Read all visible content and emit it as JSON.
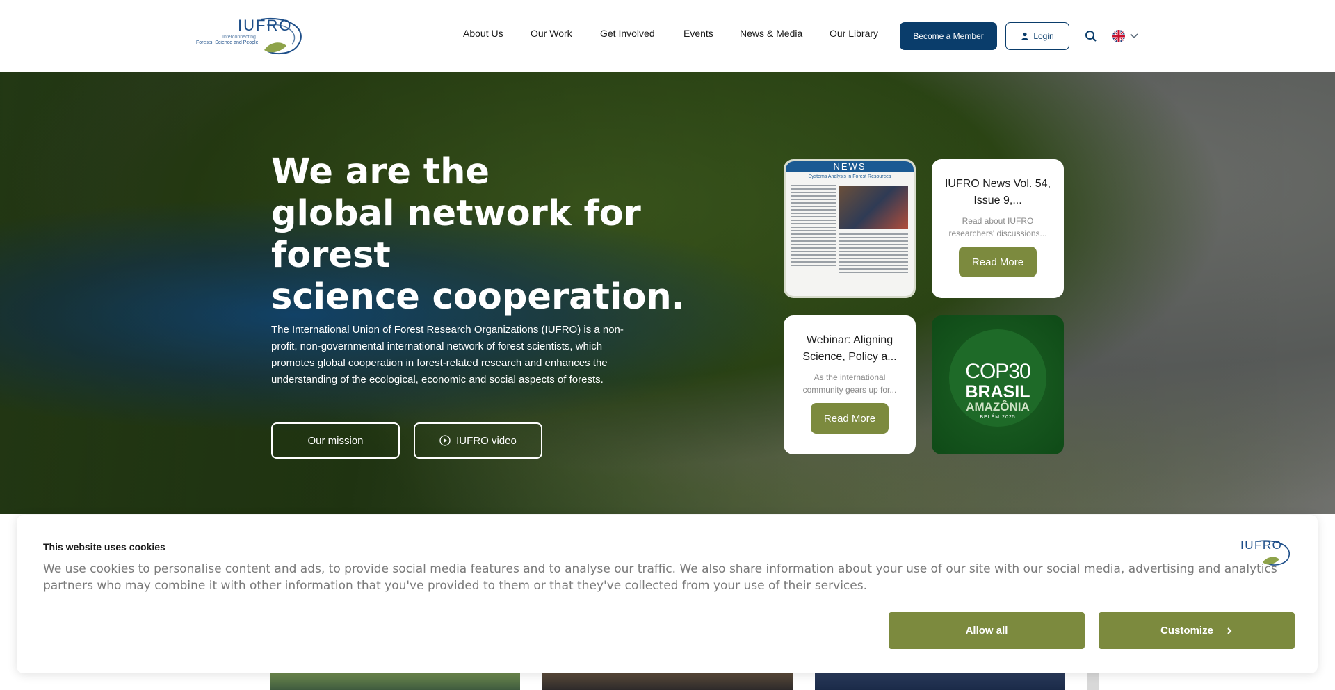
{
  "header": {
    "logo": {
      "name": "IUFRO",
      "tagline_line1": "Interconnecting",
      "tagline_line2": "Forests, Science and People"
    },
    "nav": [
      {
        "label": "About Us"
      },
      {
        "label": "Our Work"
      },
      {
        "label": "Get Involved"
      },
      {
        "label": "Events"
      },
      {
        "label": "News & Media"
      },
      {
        "label": "Our Library"
      }
    ],
    "member_label": "Become a Member",
    "login_label": "Login",
    "icons": {
      "search": "search-icon",
      "user": "user-icon",
      "language": "uk-flag-icon",
      "dropdown": "chevron-down-icon"
    }
  },
  "hero": {
    "title_line1": "We are the",
    "title_line2": "global network for forest",
    "title_line3": "science cooperation.",
    "description": "The International Union of Forest Research Organizations (IUFRO) is a non-profit, non-governmental international network of forest scientists, which promotes global cooperation in forest-related research and enhances the understanding of the ecological, economic and social aspects of forests.",
    "mission_label": "Our mission",
    "video_label": "IUFRO video"
  },
  "cards": {
    "news_image": {
      "heading": "NEWS",
      "subheading": "Systems Analysis in Forest Resources"
    },
    "news": {
      "title": "IUFRO News Vol. 54, Issue 9,...",
      "text": "Read about IUFRO researchers' discussions...",
      "button": "Read More"
    },
    "webinar": {
      "title": "Webinar: Aligning Science, Policy a...",
      "text": "As the international community gears up for...",
      "button": "Read More"
    },
    "cop": {
      "line1": "COP30",
      "line2": "BRASIL",
      "line3": "AMAZÔNIA",
      "line4": "BELÉM 2025"
    }
  },
  "cookie": {
    "title": "This website uses cookies",
    "text": "We use cookies to personalise content and ads, to provide social media features and to analyse our traffic. We also share information about your use of our site with our social media, advertising and analytics partners who may combine it with other information that you've provided to them or that they've collected from your use of their services.",
    "logo": "IUFRO",
    "allow_label": "Allow all",
    "customize_label": "Customize"
  },
  "colors": {
    "primary": "#0a3d6b",
    "olive": "#7c8a3e",
    "cop_green": "#17581f"
  }
}
